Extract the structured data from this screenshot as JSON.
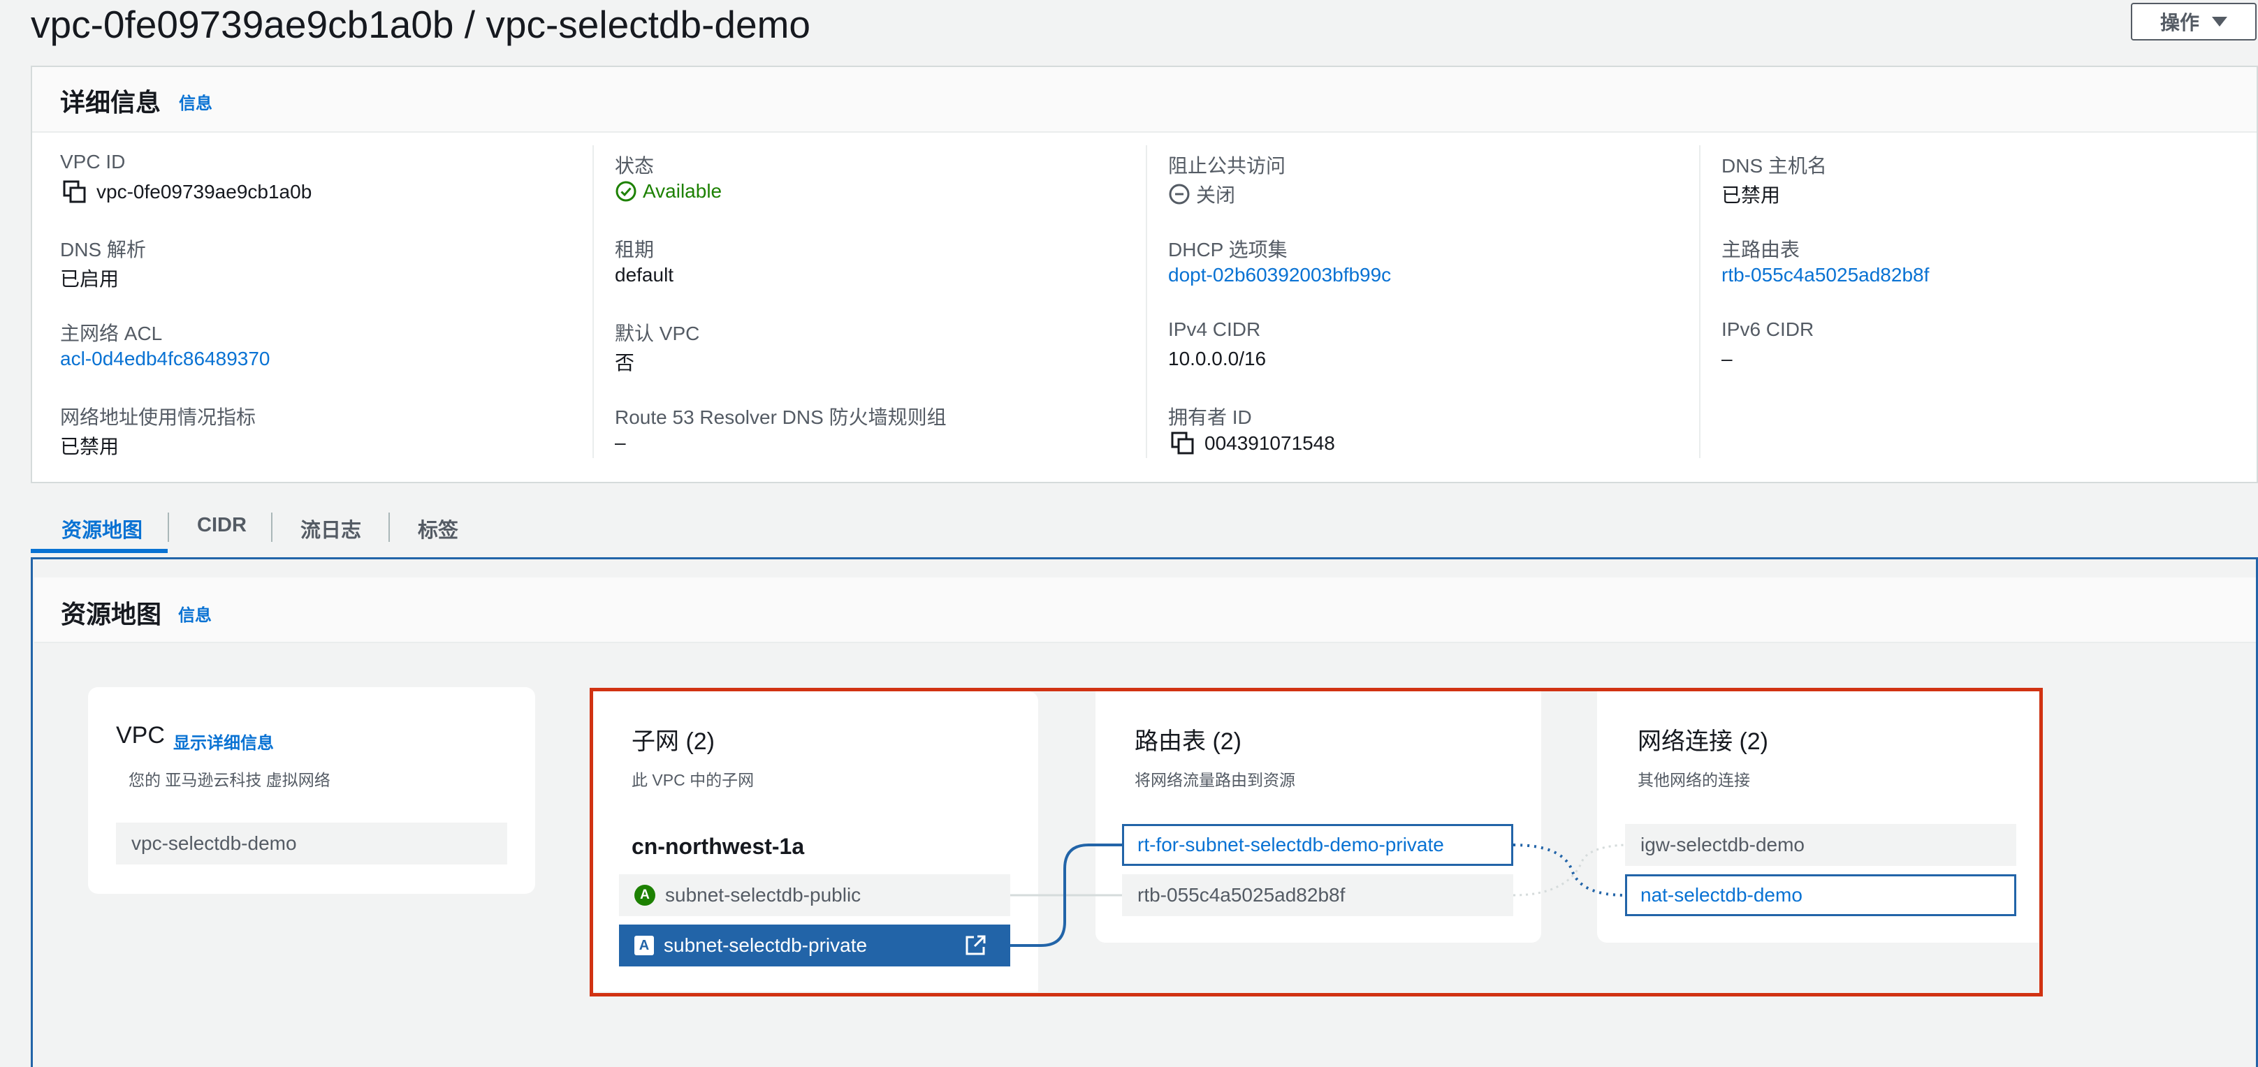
{
  "header": {
    "title": "vpc-0fe09739ae9cb1a0b / vpc-selectdb-demo",
    "actions_label": "操作"
  },
  "details": {
    "title": "详细信息",
    "info_link": "信息",
    "fields": {
      "vpc_id": {
        "label": "VPC ID",
        "value": "vpc-0fe09739ae9cb1a0b"
      },
      "state": {
        "label": "状态",
        "value": "Available"
      },
      "block_public_access": {
        "label": "阻止公共访问",
        "value": "关闭"
      },
      "dns_hostnames": {
        "label": "DNS 主机名",
        "value": "已禁用"
      },
      "dns_resolution": {
        "label": "DNS 解析",
        "value": "已启用"
      },
      "tenancy": {
        "label": "租期",
        "value": "default"
      },
      "dhcp_options": {
        "label": "DHCP 选项集",
        "value": "dopt-02b60392003bfb99c"
      },
      "main_route_table": {
        "label": "主路由表",
        "value": "rtb-055c4a5025ad82b8f"
      },
      "main_acl": {
        "label": "主网络 ACL",
        "value": "acl-0d4edb4fc86489370"
      },
      "default_vpc": {
        "label": "默认 VPC",
        "value": "否"
      },
      "ipv4_cidr": {
        "label": "IPv4 CIDR",
        "value": "10.0.0.0/16"
      },
      "ipv6_cidr": {
        "label": "IPv6 CIDR",
        "value": "–"
      },
      "address_usage": {
        "label": "网络地址使用情况指标",
        "value": "已禁用"
      },
      "route53_firewall": {
        "label": "Route 53 Resolver DNS 防火墙规则组",
        "value": "–"
      },
      "owner_id": {
        "label": "拥有者 ID",
        "value": "004391071548"
      }
    }
  },
  "tabs": [
    {
      "label": "资源地图",
      "active": true
    },
    {
      "label": "CIDR",
      "active": false
    },
    {
      "label": "流日志",
      "active": false
    },
    {
      "label": "标签",
      "active": false
    }
  ],
  "resource_map": {
    "title": "资源地图",
    "info_link": "信息",
    "vpc_card": {
      "title": "VPC",
      "show_details": "显示详细信息",
      "subtitle": "您的 亚马逊云科技 虚拟网络",
      "name": "vpc-selectdb-demo"
    },
    "subnets_card": {
      "title": "子网 (2)",
      "subtitle": "此 VPC 中的子网",
      "az": "cn-northwest-1a",
      "items": [
        {
          "badge": "A",
          "name": "subnet-selectdb-public"
        },
        {
          "badge": "A",
          "name": "subnet-selectdb-private"
        }
      ]
    },
    "route_tables_card": {
      "title": "路由表 (2)",
      "subtitle": "将网络流量路由到资源",
      "items": [
        {
          "name": "rt-for-subnet-selectdb-demo-private"
        },
        {
          "name": "rtb-055c4a5025ad82b8f"
        }
      ]
    },
    "connections_card": {
      "title": "网络连接 (2)",
      "subtitle": "其他网络的连接",
      "items": [
        {
          "name": "igw-selectdb-demo"
        },
        {
          "name": "nat-selectdb-demo"
        }
      ]
    }
  },
  "colors": {
    "link": "#0972d3",
    "success": "#1d8102",
    "selected_blue": "#2264a8",
    "highlight_red": "#d13212"
  }
}
